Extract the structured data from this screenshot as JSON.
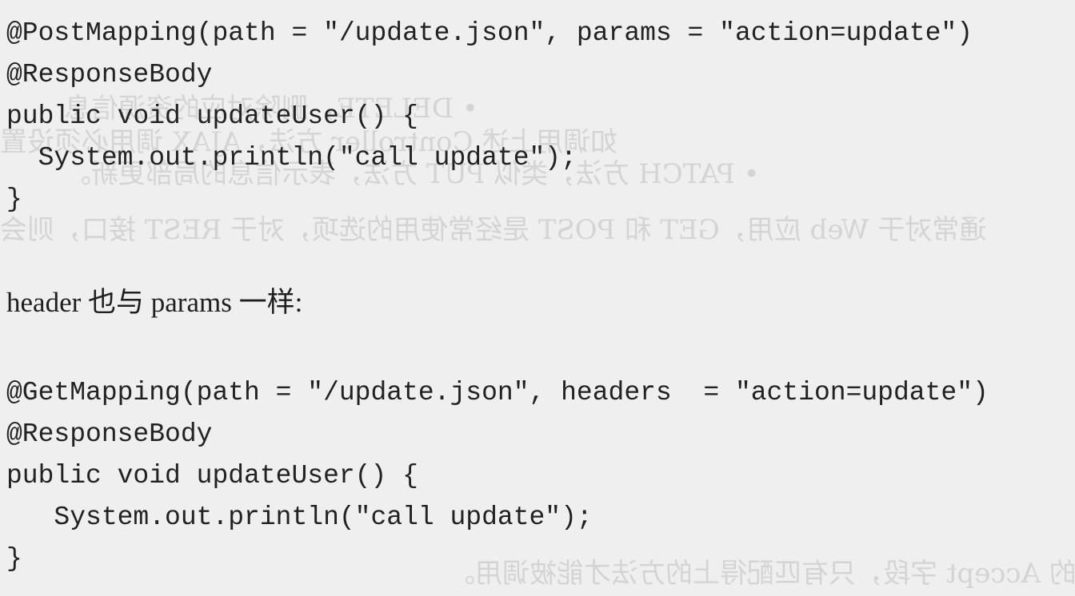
{
  "code_block_1": {
    "lines": [
      "@PostMapping(path = \"/update.json\", params = \"action=update\")",
      "@ResponseBody",
      "public void updateUser() {",
      "  System.out.println(\"call update\");",
      "}"
    ]
  },
  "paragraph": {
    "text": "header 也与 params 一样:"
  },
  "code_block_2": {
    "lines": [
      "@GetMapping(path = \"/update.json\", headers  = \"action=update\")",
      "@ResponseBody",
      "public void updateUser() {",
      "   System.out.println(\"call update\");",
      "}"
    ]
  },
  "bleed_through": [
    "如调用上述 Controller 方法，AJAX 调用必须设置",
    "通常对于 Web 应用，GET 和 POST 是经常使用的选项，对于 REST 接口，则会",
    "• DELETE，删除对应的资源信息",
    "• PATCH 方法，类似 PUT 方法，表示信息的局部更新。",
    "属性对应于 HTTP 请求的 Accept 字段，只有匹配得上的方法才能被调用。"
  ]
}
